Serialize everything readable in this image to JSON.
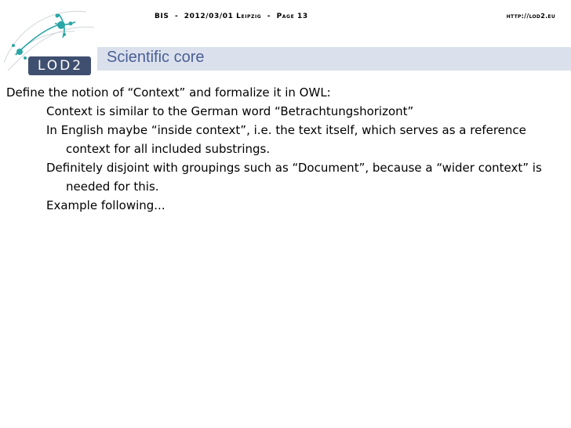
{
  "header": {
    "text": "BIS  -  2012/03/01 Leipzig  -  Page 13",
    "url": "http://lod2.eu"
  },
  "logo": {
    "text": "LOD2"
  },
  "slide": {
    "title": "Scientific core",
    "intro": "Define the notion of “Context” and formalize it in OWL:",
    "bullets": [
      "Context is similar to the German word “Betrachtungshorizont”",
      "In English maybe “inside context”, i.e. the text itself, which serves as a reference context for all included substrings.",
      "Definitely disjoint with groupings such as “Document”, because a “wider context” is needed for this.",
      "Example following..."
    ]
  },
  "colors": {
    "title": "#4a5f96",
    "title_bar": "#dbe1ec",
    "logo_teal": "#2aa6a6",
    "logo_box": "#3f4f70"
  }
}
